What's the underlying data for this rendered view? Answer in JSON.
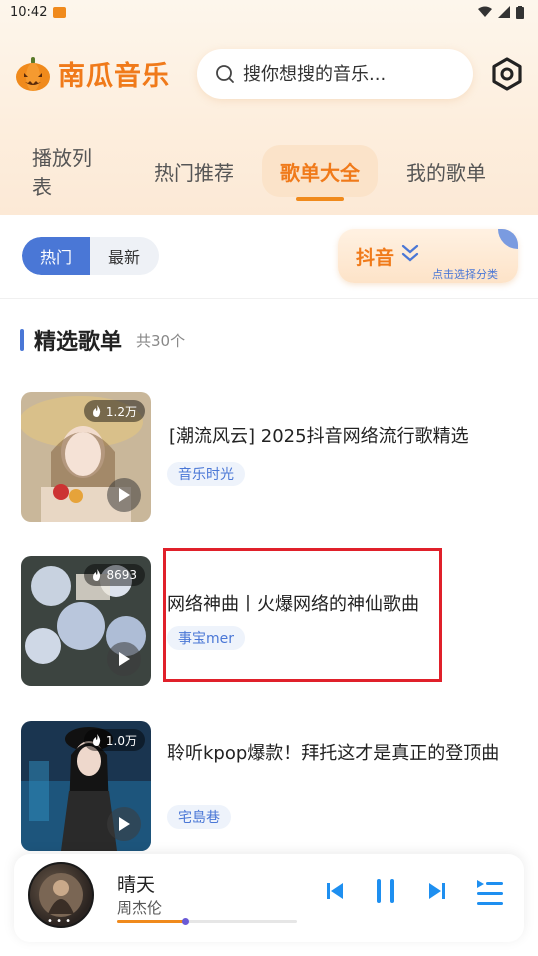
{
  "status_bar": {
    "time": "10:42"
  },
  "header": {
    "app_title": "南瓜音乐",
    "search_placeholder": "搜你想搜的音乐..."
  },
  "tabs": [
    {
      "label": "播放列表",
      "active": false
    },
    {
      "label": "热门推荐",
      "active": false
    },
    {
      "label": "歌单大全",
      "active": true
    },
    {
      "label": "我的歌单",
      "active": false
    }
  ],
  "filter": {
    "segments": [
      {
        "label": "热门",
        "active": true
      },
      {
        "label": "最新",
        "active": false
      }
    ],
    "category_label": "抖音",
    "category_hint": "点击选择分类"
  },
  "section": {
    "title": "精选歌单",
    "count": "共30个"
  },
  "playlists": [
    {
      "title": "[潮流风云] 2025抖音网络流行歌精选",
      "tag": "音乐时光",
      "plays": "1.2万"
    },
    {
      "title": "网络神曲丨火爆网络的神仙歌曲",
      "tag": "事宝mer",
      "plays": "8693"
    },
    {
      "title": "聆听kpop爆款！拜托这才是真正的登顶曲",
      "tag": "宅島巷",
      "plays": "1.0万"
    }
  ],
  "player": {
    "song": "晴天",
    "artist": "周杰伦",
    "progress": 0.38
  },
  "colors": {
    "accent": "#f07a1a",
    "blue": "#4a77d6",
    "highlight": "#e0202a"
  }
}
